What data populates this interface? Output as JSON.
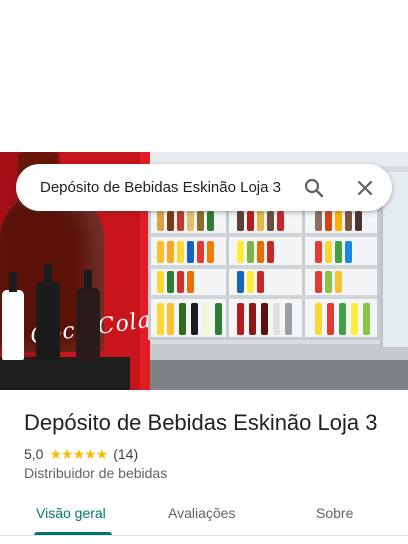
{
  "search": {
    "query": "Depósito de Bebidas Eskinão Loja 3",
    "search_icon": "search-icon",
    "close_icon": "close-icon"
  },
  "hero": {
    "bottle_label": "Coca-Cola"
  },
  "place": {
    "title": "Depósito de Bebidas Eskinão Loja 3",
    "rating": "5,0",
    "stars": "★★★★★",
    "review_count": "(14)",
    "category": "Distribuidor de bebidas"
  },
  "tabs": [
    {
      "label": "Visão geral",
      "active": true
    },
    {
      "label": "Avaliações",
      "active": false
    },
    {
      "label": "Sobre",
      "active": false
    }
  ],
  "colors": {
    "accent": "#00796b",
    "star": "#fbbc04",
    "text_primary": "#202124",
    "text_secondary": "#5f6368"
  }
}
